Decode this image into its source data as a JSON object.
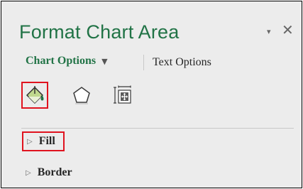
{
  "pane": {
    "title": "Format Chart Area",
    "title_controls": {
      "dropdown_glyph": "▾",
      "close_glyph": "✕"
    }
  },
  "options_tabs": {
    "chart_options_label": "Chart Options",
    "chart_options_arrow": "▼",
    "text_options_label": "Text Options",
    "active_tab": "Chart Options"
  },
  "icon_tabs": [
    {
      "name": "fill-line",
      "icon": "paint-bucket-icon",
      "selected": true
    },
    {
      "name": "effects",
      "icon": "pentagon-icon",
      "selected": false
    },
    {
      "name": "size-properties",
      "icon": "size-properties-icon",
      "selected": false
    }
  ],
  "sections": {
    "fill": {
      "label": "Fill",
      "arrow": "▷",
      "expanded": false,
      "highlighted": true
    },
    "border": {
      "label": "Border",
      "arrow": "▷",
      "expanded": false,
      "highlighted": false
    }
  },
  "colors": {
    "accent": "#217346",
    "highlight": "#e0131f",
    "pane_background": "#ececec",
    "bucket_fill": "#c0d88e"
  }
}
